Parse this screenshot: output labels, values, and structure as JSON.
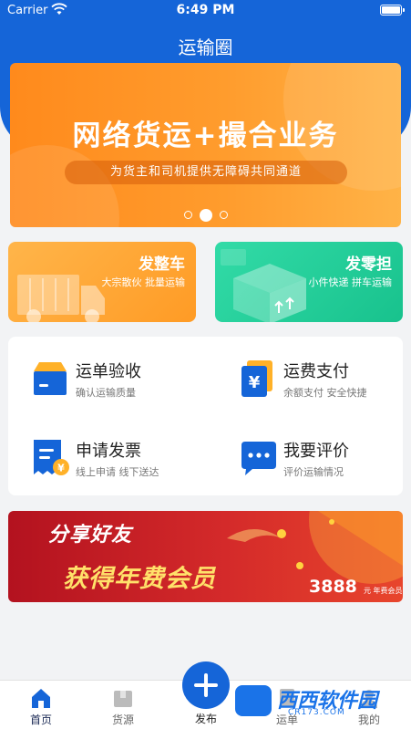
{
  "status_bar": {
    "carrier": "Carrier",
    "time": "6:49 PM"
  },
  "nav": {
    "title": "运输圈"
  },
  "banner": {
    "headline": "网络货运+撮合业务",
    "subtitle": "为货主和司机提供无障碍共同通道",
    "slide_index": 2,
    "slide_count": 3
  },
  "quick_cards": [
    {
      "title": "发整车",
      "subtitle": "大宗散伙 批量运输",
      "icon": "truck-icon"
    },
    {
      "title": "发零担",
      "subtitle": "小件快递 拼车运输",
      "icon": "package-icon"
    }
  ],
  "services": [
    {
      "title": "运单验收",
      "subtitle": "确认运输质量",
      "icon": "box-icon"
    },
    {
      "title": "运费支付",
      "subtitle": "余额支付 安全快捷",
      "icon": "yuan-wallet-icon"
    },
    {
      "title": "申请发票",
      "subtitle": "线上申请 线下送达",
      "icon": "invoice-icon"
    },
    {
      "title": "我要评价",
      "subtitle": "评价运输情况",
      "icon": "chat-bubble-icon"
    }
  ],
  "promo": {
    "line1": "分享好友",
    "line2": "获得年费会员",
    "price": "3888",
    "price_suffix": "元 年费会员"
  },
  "tabbar": {
    "items": [
      {
        "label": "首页",
        "icon": "home-icon",
        "active": true
      },
      {
        "label": "货源",
        "icon": "cargo-icon",
        "active": false
      },
      {
        "label": "发布",
        "icon": "plus-icon",
        "active": false
      },
      {
        "label": "运单",
        "icon": "waybill-icon",
        "active": false
      },
      {
        "label": "我的",
        "icon": "user-icon",
        "active": false
      }
    ]
  },
  "watermark": {
    "text": "西西软件园",
    "sub": "CR173.COM"
  },
  "colors": {
    "primary_blue": "#1565d8",
    "orange": "#ff9b25",
    "green": "#1fc993",
    "promo_red": "#d42a2a",
    "background": "#f2f3f5"
  }
}
